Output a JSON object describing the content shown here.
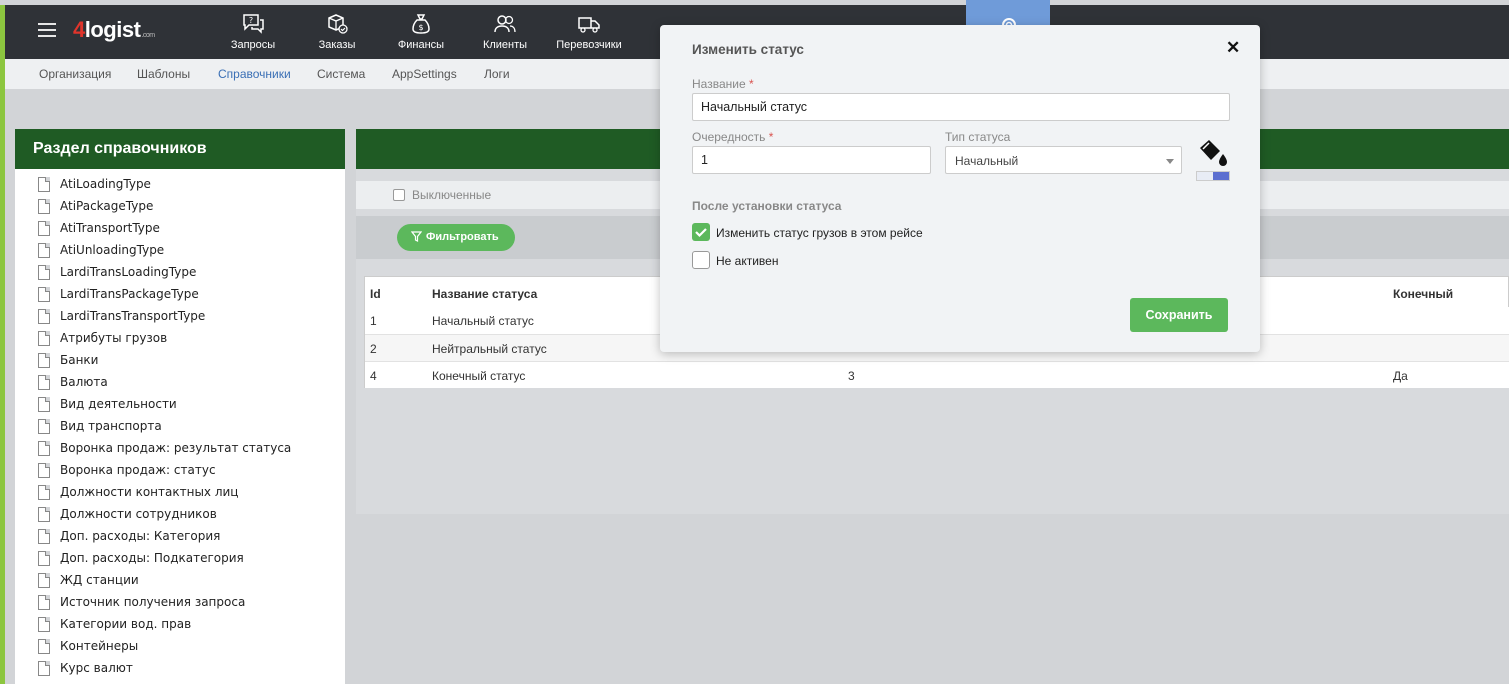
{
  "app": {
    "logo_main": "logist",
    "logo_prefix": "4",
    "logo_suffix": ".com"
  },
  "nav": [
    {
      "label": "Запросы",
      "icon": "chat-question-icon"
    },
    {
      "label": "Заказы",
      "icon": "box-check-icon"
    },
    {
      "label": "Финансы",
      "icon": "money-bag-icon"
    },
    {
      "label": "Клиенты",
      "icon": "users-icon"
    },
    {
      "label": "Перевозчики",
      "icon": "truck-icon"
    }
  ],
  "subnav": [
    "Организация",
    "Шаблоны",
    "Справочники",
    "Система",
    "AppSettings",
    "Логи"
  ],
  "subnav_active": "Справочники",
  "left_panel": {
    "title": "Раздел справочников",
    "items": [
      "AtiLoadingType",
      "AtiPackageType",
      "AtiTransportType",
      "AtiUnloadingType",
      "LardiTransLoadingType",
      "LardiTransPackageType",
      "LardiTransTransportType",
      "Атрибуты грузов",
      "Банки",
      "Валюта",
      "Вид деятельности",
      "Вид транспорта",
      "Воронка продаж: результат статуса",
      "Воронка продаж: статус",
      "Должности контактных лиц",
      "Должности сотрудников",
      "Доп. расходы: Категория",
      "Доп. расходы: Подкатегория",
      "ЖД станции",
      "Источник получения запроса",
      "Категории вод. прав",
      "Контейнеры",
      "Курс валют"
    ]
  },
  "filters": {
    "disabled_label": "Выключенные",
    "filter_button": "Фильтровать"
  },
  "table": {
    "headers": {
      "id": "Id",
      "name": "Название статуса",
      "final": "Конечный"
    },
    "rows": [
      {
        "id": "1",
        "name": "Начальный статус",
        "order": "",
        "final": ""
      },
      {
        "id": "2",
        "name": "Нейтральный статус",
        "order": "",
        "final": ""
      },
      {
        "id": "4",
        "name": "Конечный статус",
        "order": "3",
        "final": "Да"
      }
    ]
  },
  "modal": {
    "title": "Изменить статус",
    "close": "✕",
    "name_label": "Название",
    "name_value": "Начальный статус",
    "order_label": "Очередность",
    "order_value": "1",
    "type_label": "Тип статуса",
    "type_value": "Начальный",
    "required_mark": "*",
    "after_section": "После установки статуса",
    "check1_label": "Изменить статус грузов в этом рейсе",
    "check1_checked": true,
    "check2_label": "Не активен",
    "check2_checked": false,
    "save": "Сохранить"
  },
  "colors": {
    "accent_green": "#5cb85c",
    "header_green": "#1f5b24",
    "topbar": "#2f3237",
    "active_nav": "#6f9bd9",
    "side_stripe": "#8cc63f"
  }
}
